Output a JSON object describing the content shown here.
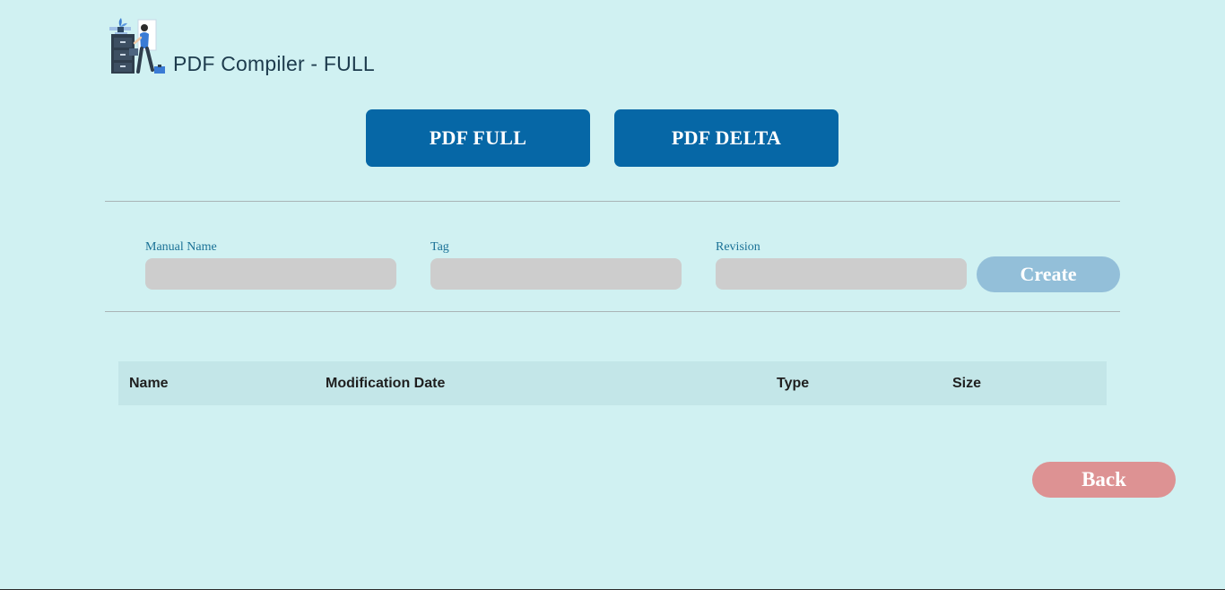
{
  "header": {
    "title": "PDF Compiler - FULL",
    "logo_icon": "filing-cabinet-person-illustration"
  },
  "mode_buttons": {
    "full_label": "PDF FULL",
    "delta_label": "PDF DELTA"
  },
  "form": {
    "manual_name": {
      "label": "Manual Name",
      "value": ""
    },
    "tag": {
      "label": "Tag",
      "value": ""
    },
    "revision": {
      "label": "Revision",
      "value": ""
    },
    "create_label": "Create"
  },
  "table": {
    "columns": [
      "Name",
      "Modification Date",
      "Type",
      "Size"
    ],
    "rows": []
  },
  "back_label": "Back",
  "colors": {
    "background": "#d0f1f2",
    "primary_button": "#0667a6",
    "create_button": "#93bfd9",
    "back_button": "#dd9293",
    "input_background": "#cdcdcd",
    "label_text": "#1a7196"
  }
}
